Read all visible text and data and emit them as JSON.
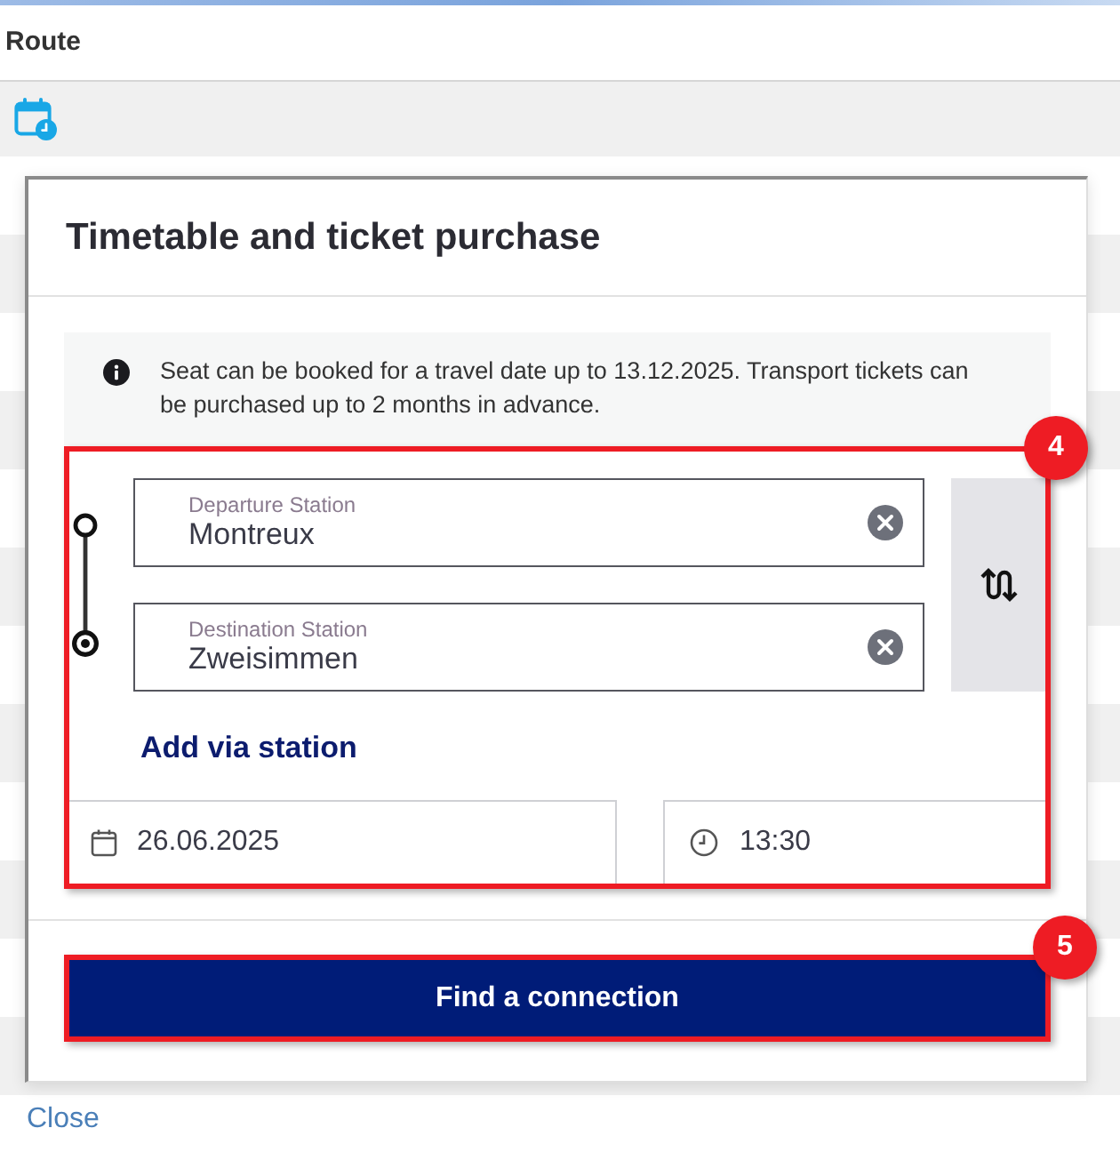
{
  "header": {
    "title": "Route"
  },
  "dialog": {
    "title": "Timetable and ticket purchase",
    "notice": "Seat can be booked for a travel date up to 13.12.2025. Transport tickets can be purchased up to 2 months in advance.",
    "route_form": {
      "annotation": "4",
      "stations": [
        {
          "label": "Departure Station",
          "value": "Montreux"
        },
        {
          "label": "Destination Station",
          "value": "Zweisimmen"
        }
      ],
      "via_link": "Add via station",
      "date": "26.06.2025",
      "time": "13:30"
    },
    "submit": {
      "label": "Find a connection",
      "annotation": "5"
    }
  },
  "close_link": "Close"
}
